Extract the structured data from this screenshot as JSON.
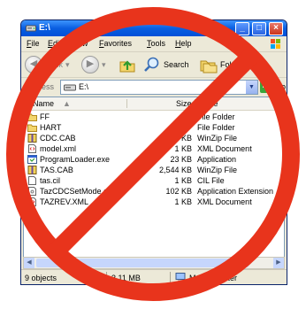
{
  "window": {
    "title": "E:\\",
    "accent": "#0a5ee0",
    "controls": {
      "minimize": "_",
      "maximize": "□",
      "close": "×"
    }
  },
  "menu": [
    "File",
    "Edit",
    "View",
    "Favorites",
    "Tools",
    "Help"
  ],
  "toolbar": {
    "back_label": "Back",
    "search_label": "Search",
    "folders_label": "Folders"
  },
  "address": {
    "label": "Address",
    "value": "E:\\",
    "go_label": "Go"
  },
  "columns": {
    "name": "Name",
    "size": "Size",
    "type": "Type"
  },
  "files": [
    {
      "name": "FF",
      "size": "",
      "type": "File Folder",
      "icon": "folder-icon"
    },
    {
      "name": "HART",
      "size": "",
      "type": "File Folder",
      "icon": "folder-icon"
    },
    {
      "name": "CDC.CAB",
      "size": "520 KB",
      "type": "WinZip File",
      "icon": "winzip-icon"
    },
    {
      "name": "model.xml",
      "size": "1 KB",
      "type": "XML Document",
      "icon": "xml-icon"
    },
    {
      "name": "ProgramLoader.exe",
      "size": "23 KB",
      "type": "Application",
      "icon": "exe-icon"
    },
    {
      "name": "TAS.CAB",
      "size": "2,544 KB",
      "type": "WinZip File",
      "icon": "winzip-icon"
    },
    {
      "name": "tas.cil",
      "size": "1 KB",
      "type": "CIL File",
      "icon": "file-icon"
    },
    {
      "name": "TazCDCSetMode.dll",
      "size": "102 KB",
      "type": "Application Extension",
      "icon": "dll-icon"
    },
    {
      "name": "TAZREV.XML",
      "size": "1 KB",
      "type": "XML Document",
      "icon": "xml-icon"
    }
  ],
  "status": {
    "objects": "9 objects",
    "size": "3.11 MB",
    "location": "My Computer"
  },
  "prohibition_color": "#e8341c"
}
